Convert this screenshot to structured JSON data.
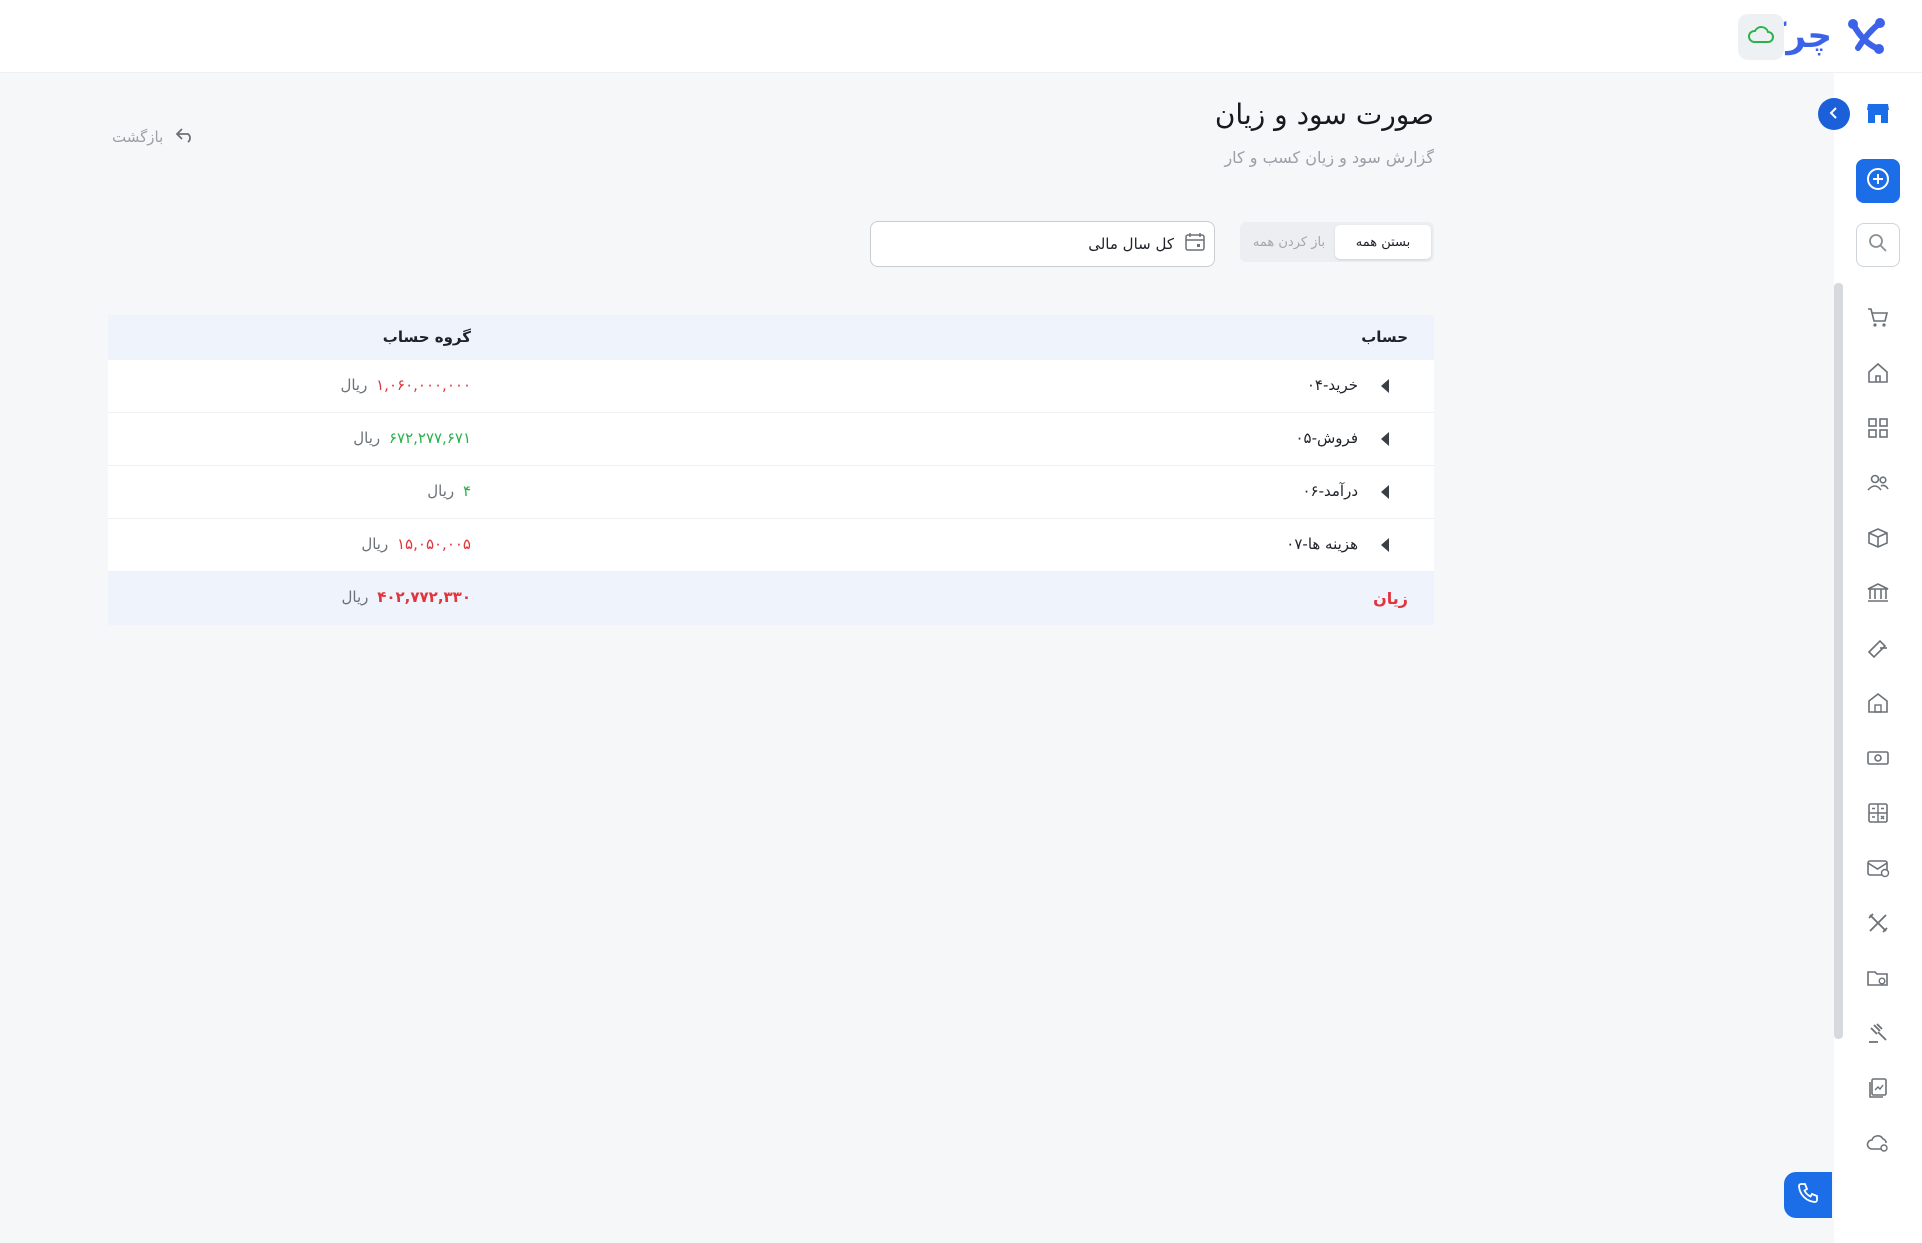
{
  "header": {
    "logo_text": "چرکه",
    "cloud_icon": "cloud-icon",
    "colors": {
      "brand": "#3b62e8",
      "cloud": "#2bb24c"
    }
  },
  "sidebar": {
    "items": [
      {
        "name": "store",
        "icon": "store-icon"
      },
      {
        "name": "add",
        "icon": "plus-circle-icon"
      },
      {
        "name": "search",
        "icon": "search-icon"
      },
      {
        "name": "shopping",
        "icon": "cart-icon"
      },
      {
        "name": "home",
        "icon": "home-icon"
      },
      {
        "name": "dashboard",
        "icon": "grid-icon"
      },
      {
        "name": "people",
        "icon": "users-icon"
      },
      {
        "name": "products",
        "icon": "box-icon"
      },
      {
        "name": "bank",
        "icon": "bank-icon"
      },
      {
        "name": "checks",
        "icon": "check-icon"
      },
      {
        "name": "warehouse",
        "icon": "warehouse-icon"
      },
      {
        "name": "cash",
        "icon": "cash-icon"
      },
      {
        "name": "accounting",
        "icon": "calculator-icon"
      },
      {
        "name": "messages",
        "icon": "mail-icon"
      },
      {
        "name": "tools",
        "icon": "tools-icon"
      },
      {
        "name": "documents",
        "icon": "folder-icon"
      },
      {
        "name": "legal",
        "icon": "gavel-icon"
      },
      {
        "name": "reports",
        "icon": "report-icon"
      },
      {
        "name": "cloud-settings",
        "icon": "cloud-settings-icon"
      }
    ],
    "accent": "#1b6ee8"
  },
  "page": {
    "title": "صورت سود و زیان",
    "subtitle": "گزارش سود و زیان کسب و کار",
    "back_label": "بازگشت"
  },
  "controls": {
    "expand_all": "باز کردن همه",
    "collapse_all": "بستن همه",
    "period_value": "کل سال مالی"
  },
  "table": {
    "headers": {
      "account": "حساب",
      "group": "گروه حساب"
    },
    "currency": "ریال",
    "rows": [
      {
        "account": "۰۴-خرید",
        "amount": "۱,۰۶۰,۰۰۰,۰۰۰",
        "tone": "negative"
      },
      {
        "account": "۰۵-فروش",
        "amount": "۶۷۲,۲۷۷,۶۷۱",
        "tone": "positive"
      },
      {
        "account": "۰۶-درآمد",
        "amount": "۴",
        "tone": "positive"
      },
      {
        "account": "۰۷-هزینه ها",
        "amount": "۱۵,۰۵۰,۰۰۵",
        "tone": "negative"
      }
    ],
    "total": {
      "label": "زیان",
      "amount": "۴۰۲,۷۷۲,۳۳۰"
    },
    "colors": {
      "negative": "#e1343c",
      "positive": "#2bb24c"
    }
  }
}
